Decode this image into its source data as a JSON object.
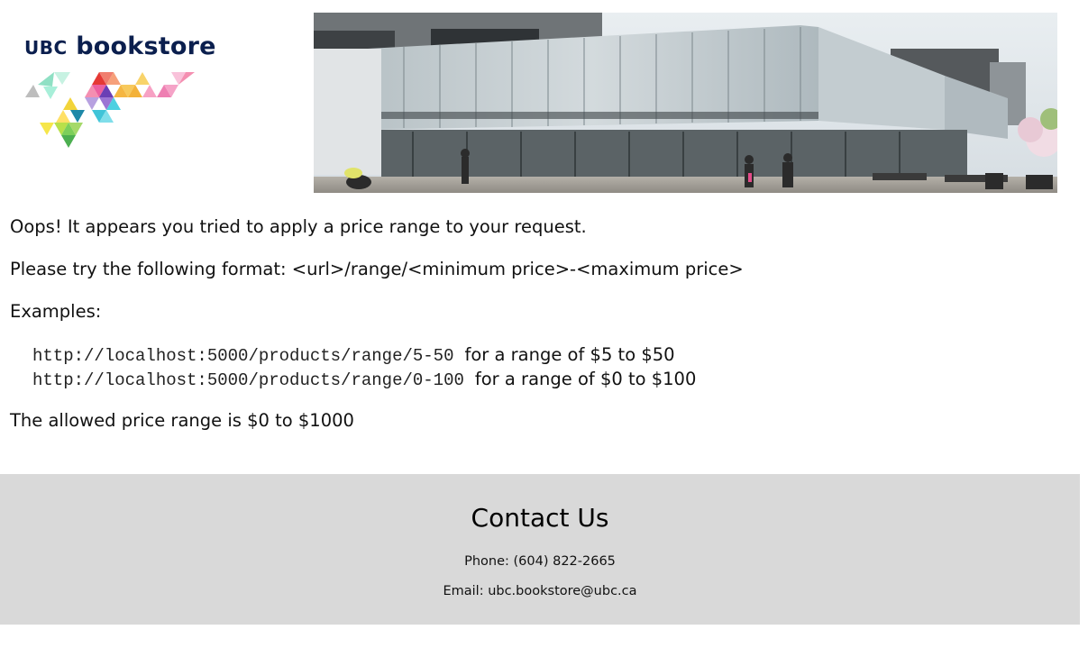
{
  "header": {
    "logo_ubc": "UBC",
    "logo_name": "bookstore"
  },
  "message": {
    "line1": "Oops! It appears you tried to apply a price range to your request.",
    "line2": "Please try the following format: <url>/range/<minimum price>-<maximum price>",
    "examples_label": "Examples:",
    "examples": [
      {
        "url": "http://localhost:5000/products/range/5-50",
        "desc": "for a range of $5 to $50"
      },
      {
        "url": "http://localhost:5000/products/range/0-100",
        "desc": "for a range of $0 to $100"
      }
    ],
    "allowed": "The allowed price range is $0 to $1000"
  },
  "footer": {
    "title": "Contact Us",
    "phone": "Phone: (604) 822-2665",
    "email": "Email: ubc.bookstore@ubc.ca"
  },
  "colors": {
    "logo_navy": "#0b1f4e",
    "footer_bg": "#d9d9d9"
  }
}
